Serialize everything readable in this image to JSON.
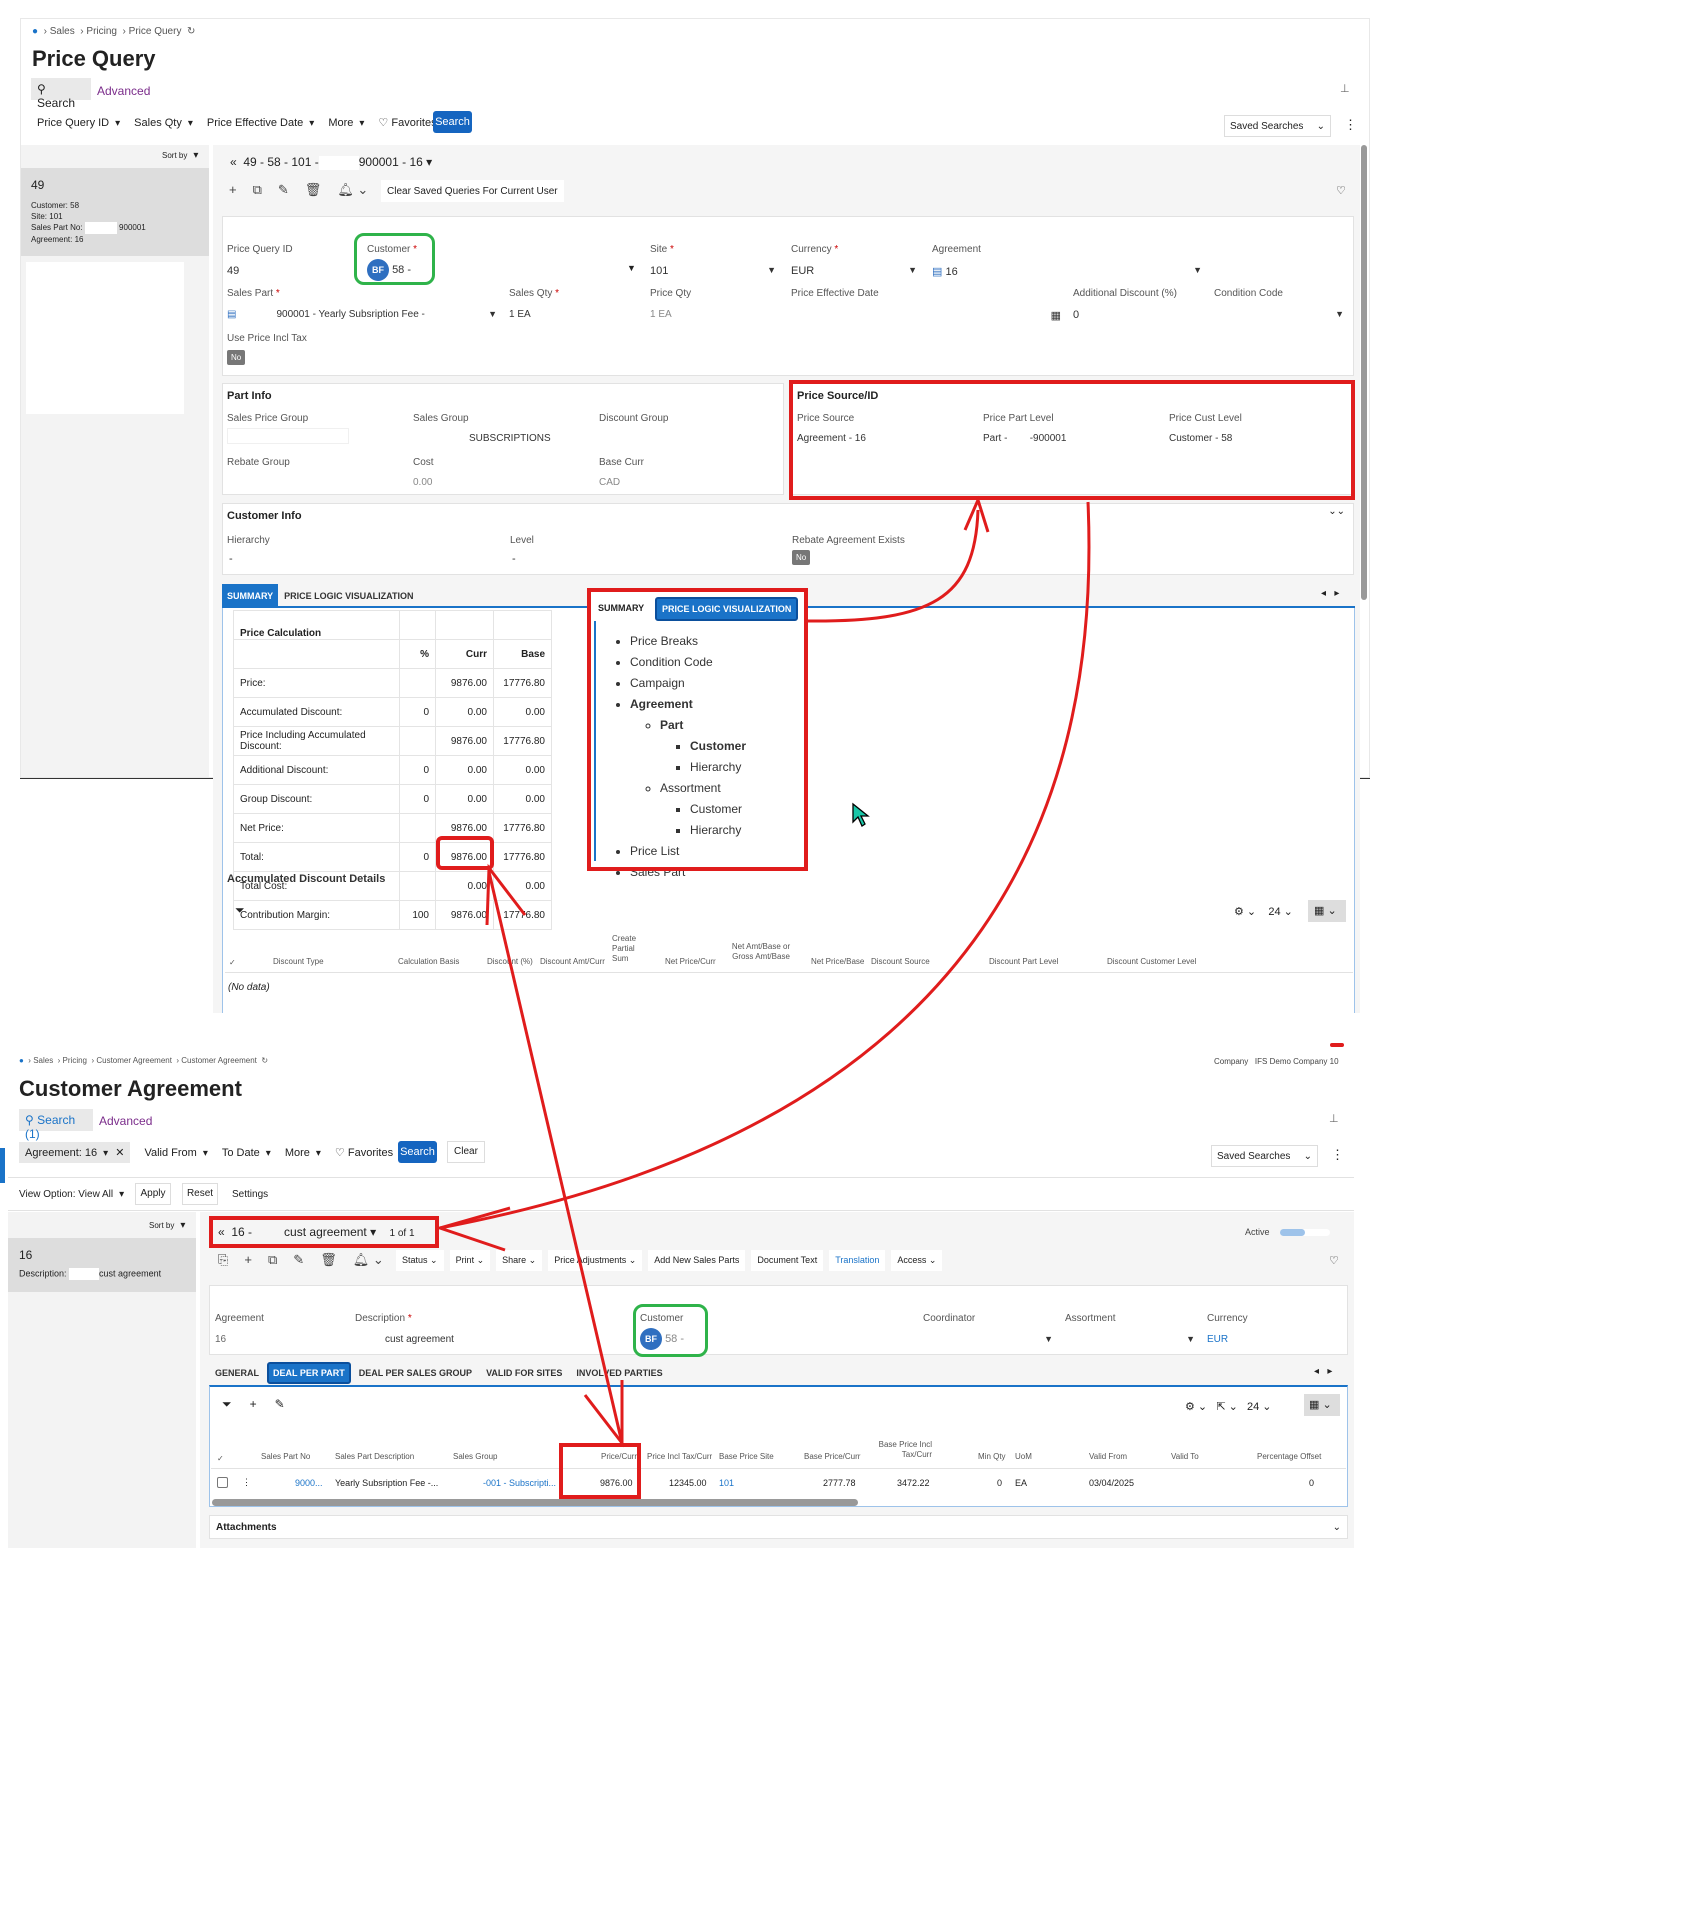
{
  "top": {
    "breadcrumb": [
      "Sales",
      "Pricing",
      "Price Query"
    ],
    "title": "Price Query",
    "search_tab": "Search",
    "advanced_tab": "Advanced",
    "filters": [
      "Price Query ID",
      "Sales Qty",
      "Price Effective Date",
      "More"
    ],
    "favorites": "Favorites",
    "search_button": "Search",
    "saved_searches": "Saved Searches",
    "sort_by": "Sort by",
    "list_item": {
      "id": "49",
      "customer_label": "Customer:",
      "customer": "58",
      "site_label": "Site:",
      "site": "101",
      "part_label": "Sales Part No:",
      "part": "900001",
      "agreement_label": "Agreement:",
      "agreement": "16"
    },
    "record_title": "49 - 58 - 101 -",
    "record_title2": "900001 - 16",
    "clear_button": "Clear Saved Queries For Current User",
    "header_fields": {
      "price_query_id_label": "Price Query ID",
      "price_query_id": "49",
      "customer_label": "Customer",
      "customer_initials": "BF",
      "customer": "58 -",
      "site_label": "Site",
      "site": "101",
      "currency_label": "Currency",
      "currency": "EUR",
      "agreement_label": "Agreement",
      "agreement": "16",
      "sales_part_label": "Sales Part",
      "sales_part": "900001 - Yearly Subsription Fee -",
      "sales_qty_label": "Sales Qty",
      "sales_qty": "1 EA",
      "price_qty_label": "Price Qty",
      "price_qty": "1 EA",
      "price_eff_label": "Price Effective Date",
      "add_disc_label": "Additional Discount (%)",
      "add_disc": "0",
      "cond_code_label": "Condition Code",
      "use_price_label": "Use Price Incl Tax",
      "use_price": "No"
    },
    "part_info": {
      "title": "Part Info",
      "sales_price_group": "Sales Price Group",
      "sales_group": "Sales Group",
      "sales_group_val": "SUBSCRIPTIONS",
      "discount_group": "Discount Group",
      "rebate_group": "Rebate Group",
      "cost": "Cost",
      "cost_val": "0.00",
      "base_curr": "Base Curr",
      "base_curr_val": "CAD"
    },
    "price_source": {
      "title": "Price Source/ID",
      "source_label": "Price Source",
      "source": "Agreement - 16",
      "part_level_label": "Price Part Level",
      "part_level": "Part -",
      "part_level2": "-900001",
      "cust_level_label": "Price Cust Level",
      "cust_level": "Customer - 58"
    },
    "customer_info": {
      "title": "Customer Info",
      "hierarchy": "Hierarchy",
      "hierarchy_val": "-",
      "level": "Level",
      "level_val": "-",
      "rebate": "Rebate Agreement Exists",
      "rebate_val": "No"
    },
    "tabs": [
      "SUMMARY",
      "PRICE LOGIC VISUALIZATION"
    ],
    "price_calc": {
      "title": "Price Calculation",
      "cols": [
        "%",
        "Curr",
        "Base"
      ],
      "rows": [
        [
          "Price:",
          "",
          "9876.00",
          "17776.80"
        ],
        [
          "Accumulated Discount:",
          "0",
          "0.00",
          "0.00"
        ],
        [
          "Price Including Accumulated Discount:",
          "",
          "9876.00",
          "17776.80"
        ],
        [
          "Additional Discount:",
          "0",
          "0.00",
          "0.00"
        ],
        [
          "Group Discount:",
          "0",
          "0.00",
          "0.00"
        ],
        [
          "Net Price:",
          "",
          "9876.00",
          "17776.80"
        ],
        [
          "Total:",
          "0",
          "9876.00",
          "17776.80"
        ],
        [
          "Total Cost:",
          "",
          "0.00",
          "0.00"
        ],
        [
          "Contribution Margin:",
          "100",
          "9876.00",
          "17776.80"
        ]
      ]
    },
    "popup": {
      "tabs": [
        "SUMMARY",
        "PRICE LOGIC VISUALIZATION"
      ],
      "tree": {
        "l1a": [
          "Price Breaks",
          "Condition Code",
          "Campaign"
        ],
        "agreement": "Agreement",
        "part": "Part",
        "part_children": [
          "Customer",
          "Hierarchy"
        ],
        "assortment": "Assortment",
        "assort_children": [
          "Customer",
          "Hierarchy"
        ],
        "l1b": [
          "Price List",
          "Sales Part"
        ]
      }
    },
    "acc": {
      "title": "Accumulated Discount Details",
      "page_size": "24",
      "cols": [
        "Discount Type",
        "Calculation Basis",
        "Discount (%)",
        "Discount Amt/Curr",
        "Create Partial Sum",
        "Net Price/Curr",
        "Net Amt/Base or Gross Amt/Base",
        "Net Price/Base",
        "Discount Source",
        "Discount Part Level",
        "Discount Customer Level"
      ],
      "empty": "(No data)"
    }
  },
  "bottom": {
    "breadcrumb": [
      "Sales",
      "Pricing",
      "Customer Agreement",
      "Customer Agreement"
    ],
    "company_label": "Company",
    "company": "IFS Demo Company 10",
    "title": "Customer Agreement",
    "search_tab": "Search (1)",
    "advanced_tab": "Advanced",
    "filters": [
      "Agreement: 16",
      "Valid From",
      "To Date",
      "More"
    ],
    "favorites": "Favorites",
    "search_button": "Search",
    "clear_button": "Clear",
    "saved_searches": "Saved Searches",
    "view_option": "View Option: View All",
    "apply": "Apply",
    "reset": "Reset",
    "settings": "Settings",
    "sort_by": "Sort by",
    "list_item": {
      "id": "16",
      "desc_label": "Description:",
      "desc": "cust agreement"
    },
    "record_title": "16 -",
    "record_title2": "cust agreement",
    "record_count": "1 of 1",
    "active": "Active",
    "toolbar": [
      "Status",
      "Print",
      "Share",
      "Price Adjustments",
      "Add New Sales Parts",
      "Document Text",
      "Translation",
      "Access"
    ],
    "fields": {
      "agreement_label": "Agreement",
      "agreement": "16",
      "desc_label": "Description",
      "desc": "cust agreement",
      "customer_label": "Customer",
      "customer_initials": "BF",
      "customer": "58 -",
      "coordinator": "Coordinator",
      "assortment": "Assortment",
      "currency_label": "Currency",
      "currency": "EUR"
    },
    "tabs": [
      "GENERAL",
      "DEAL PER PART",
      "DEAL PER SALES GROUP",
      "VALID FOR SITES",
      "INVOLVED PARTIES"
    ],
    "page_size": "24",
    "cols": [
      "Sales Part No",
      "Sales Part Description",
      "Sales Group",
      "Price/Curr",
      "Price Incl Tax/Curr",
      "Base Price Site",
      "Base Price/Curr",
      "Base Price Incl Tax/Curr",
      "Min Qty",
      "UoM",
      "Valid From",
      "Valid To",
      "Percentage Offset"
    ],
    "row": [
      "9000...",
      "Yearly Subsription Fee -...",
      "-001 - Subscripti...",
      "9876.00",
      "12345.00",
      "101",
      "2777.78",
      "3472.22",
      "0",
      "EA",
      "03/04/2025",
      "",
      "0"
    ],
    "attachments": "Attachments"
  },
  "colors": {
    "accent": "#1a73c8",
    "red": "#e01c1c",
    "green": "#2fb34a"
  }
}
